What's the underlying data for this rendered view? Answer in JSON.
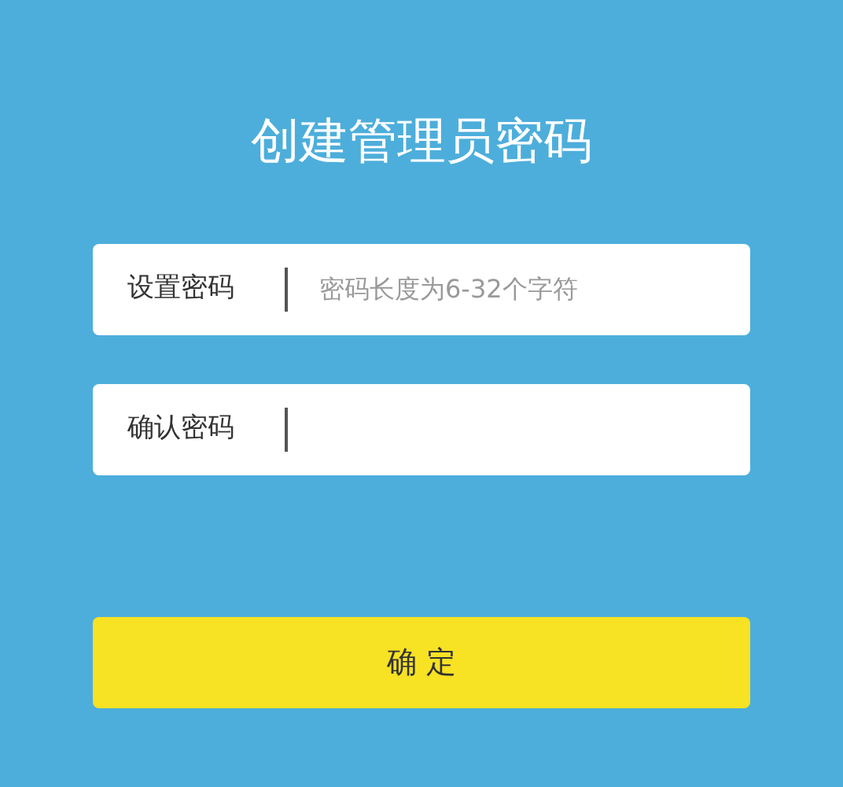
{
  "title": "创建管理员密码",
  "fields": [
    {
      "label": "设置密码",
      "placeholder": "密码长度为6-32个字符"
    },
    {
      "label": "确认密码"
    }
  ],
  "button": {
    "label": "确 定"
  }
}
